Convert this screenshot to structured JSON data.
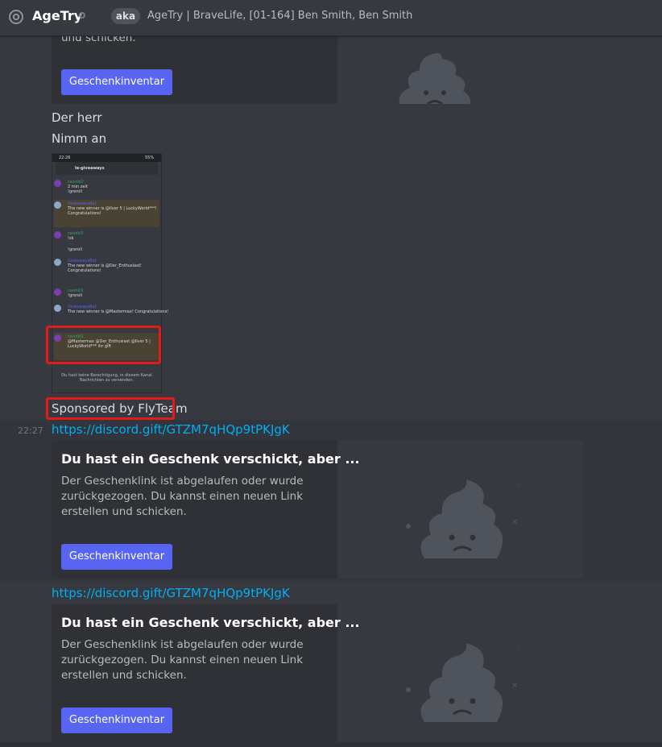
{
  "header": {
    "at_icon": "at-icon",
    "name": "AgeTry",
    "aka_label": "aka",
    "aka_names": "AgeTry | BraveLife, [01-164] Ben Smith, Ben Smith"
  },
  "messages": {
    "top_gift": {
      "desc_tail": "und schicken.",
      "button": "Geschenkinventar"
    },
    "line1": "Der herr",
    "line2": "Nimm an",
    "screenshot": {
      "status_time": "22:26",
      "status_right": "55%",
      "channel": "le-giveaways",
      "rows": [
        {
          "name": "ravinkO",
          "text1": "2 min zeit",
          "text2": "!greroll"
        },
        {
          "name": "GiveawaysBot",
          "text1": "The new winner is @Ilver 5 | LuckyWorld***!",
          "text2": "Congratulations!"
        },
        {
          "name": "ravinkO",
          "text1": "!sk",
          "text2": "!greroll"
        },
        {
          "name": "GiveawaysBot",
          "text1": "The new winner is @Der_Enthusiast!",
          "text2": "Congratulations!"
        },
        {
          "name": "ravinkO",
          "text1": "!greroll",
          "text2": ""
        },
        {
          "name": "GiveawaysBot",
          "text1": "The new winner is @Mastermax! Congratulations!",
          "text2": ""
        },
        {
          "name": "ravinkO",
          "text1": "@Mastermax @Der_Enthusiast @Ilver 5 |",
          "text2": "LuckyWorld*** ihr gift"
        }
      ],
      "footer": "Du hast keine Berechtigung, in diesem Kanal Nachrichten zu versenden."
    },
    "sponsor": "Sponsored by FlyTeam",
    "timestamp": "22:27",
    "link1": "https://discord.gift/GTZM7qHQp9tPKJgK",
    "link2": "https://discord.gift/GTZM7qHQp9tPKJgK",
    "gift": {
      "title": "Du hast ein Geschenk verschickt, aber ...",
      "desc": "Der Geschenklink ist abgelaufen oder wurde zurückgezogen. Du kannst einen neuen Link erstellen und schicken.",
      "button": "Geschenkinventar"
    }
  },
  "colors": {
    "background": "#36393f",
    "link": "#00aff4",
    "button": "#5865f2",
    "highlight": "#e31b1b"
  }
}
